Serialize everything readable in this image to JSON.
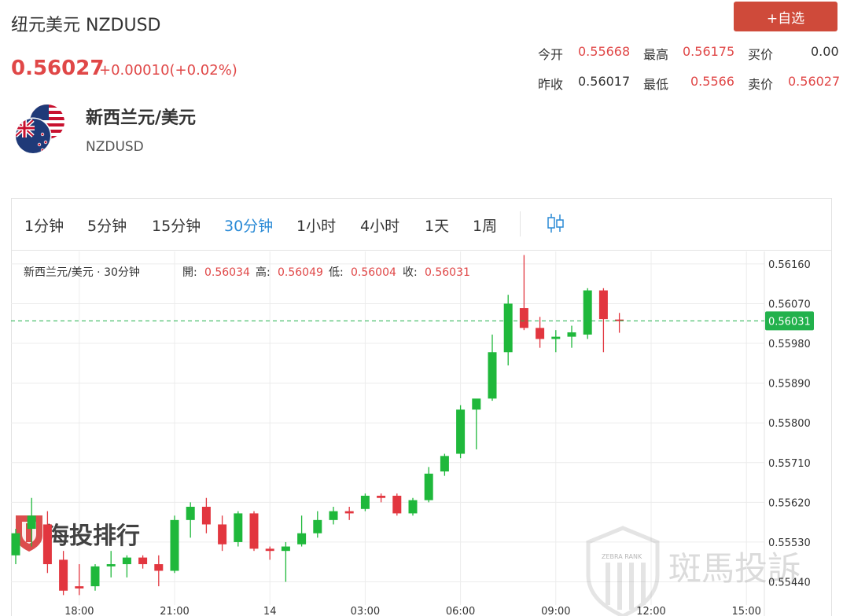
{
  "header": {
    "title": "纽元美元 NZDUSD",
    "price": "0.56027",
    "change": "+0.00010(+0.02%)",
    "fav_button": "+自选"
  },
  "stats": {
    "open_label": "今开",
    "open_value": "0.55668",
    "high_label": "最高",
    "high_value": "0.56175",
    "bid_label": "买价",
    "bid_value": "0.00",
    "prev_label": "昨收",
    "prev_value": "0.56017",
    "low_label": "最低",
    "low_value": "0.5566",
    "ask_label": "卖价",
    "ask_value": "0.56027"
  },
  "pair": {
    "name": "新西兰元/美元",
    "code": "NZDUSD"
  },
  "tabs": [
    "1分钟",
    "5分钟",
    "15分钟",
    "30分钟",
    "1小时",
    "4小时",
    "1天",
    "1周"
  ],
  "active_tab": "30分钟",
  "chart_info": {
    "name": "新西兰元/美元 · 30分钟",
    "open_label": "開:",
    "open": "0.56034",
    "high_label": "高:",
    "high": "0.56049",
    "low_label": "低:",
    "low": "0.56004",
    "close_label": "收:",
    "close": "0.56031"
  },
  "watermarks": {
    "left": "海投排行",
    "right": "斑馬投訴",
    "badge": "ZEBRA RANK"
  },
  "colors": {
    "up": "#1fb83b",
    "down": "#e2363f",
    "accent_red": "#e04747",
    "active_blue": "#2a8ad6",
    "last_price": "#22b14c"
  },
  "chart_data": {
    "type": "candlestick",
    "ylim": [
      0.554,
      0.5619
    ],
    "y_ticks": [
      "0.56160",
      "0.56070",
      "0.55980",
      "0.55890",
      "0.55800",
      "0.55710",
      "0.55620",
      "0.55530",
      "0.55440"
    ],
    "x_ticks": [
      {
        "label": "18:00",
        "index": 4
      },
      {
        "label": "21:00",
        "index": 10
      },
      {
        "label": "14",
        "index": 16
      },
      {
        "label": "03:00",
        "index": 22
      },
      {
        "label": "06:00",
        "index": 28
      },
      {
        "label": "09:00",
        "index": 34
      },
      {
        "label": "12:00",
        "index": 40
      },
      {
        "label": "15:00",
        "index": 46
      }
    ],
    "last_price": "0.56031",
    "last_price_value": 0.56031,
    "candles": [
      {
        "o": 0.555,
        "h": 0.5556,
        "l": 0.5548,
        "c": 0.5555
      },
      {
        "o": 0.5556,
        "h": 0.5563,
        "l": 0.5552,
        "c": 0.5559
      },
      {
        "o": 0.5557,
        "h": 0.556,
        "l": 0.5546,
        "c": 0.5548
      },
      {
        "o": 0.5549,
        "h": 0.5551,
        "l": 0.5541,
        "c": 0.5542
      },
      {
        "o": 0.5543,
        "h": 0.5548,
        "l": 0.5541,
        "c": 0.55425
      },
      {
        "o": 0.5543,
        "h": 0.5548,
        "l": 0.5542,
        "c": 0.55475
      },
      {
        "o": 0.55475,
        "h": 0.5551,
        "l": 0.5545,
        "c": 0.5548
      },
      {
        "o": 0.5548,
        "h": 0.555,
        "l": 0.5545,
        "c": 0.55495
      },
      {
        "o": 0.55495,
        "h": 0.555,
        "l": 0.5547,
        "c": 0.5548
      },
      {
        "o": 0.5548,
        "h": 0.555,
        "l": 0.5543,
        "c": 0.55465
      },
      {
        "o": 0.55465,
        "h": 0.5559,
        "l": 0.5546,
        "c": 0.5558
      },
      {
        "o": 0.5558,
        "h": 0.5562,
        "l": 0.5554,
        "c": 0.5561
      },
      {
        "o": 0.5561,
        "h": 0.5563,
        "l": 0.5555,
        "c": 0.5557
      },
      {
        "o": 0.5557,
        "h": 0.5559,
        "l": 0.5551,
        "c": 0.55525
      },
      {
        "o": 0.5553,
        "h": 0.556,
        "l": 0.5552,
        "c": 0.55595
      },
      {
        "o": 0.55595,
        "h": 0.556,
        "l": 0.5551,
        "c": 0.55515
      },
      {
        "o": 0.55515,
        "h": 0.5552,
        "l": 0.5549,
        "c": 0.5551
      },
      {
        "o": 0.5551,
        "h": 0.5553,
        "l": 0.5544,
        "c": 0.5552
      },
      {
        "o": 0.55525,
        "h": 0.5559,
        "l": 0.5552,
        "c": 0.5555
      },
      {
        "o": 0.5555,
        "h": 0.556,
        "l": 0.5554,
        "c": 0.5558
      },
      {
        "o": 0.5558,
        "h": 0.5561,
        "l": 0.5557,
        "c": 0.556
      },
      {
        "o": 0.556,
        "h": 0.5561,
        "l": 0.5558,
        "c": 0.55595
      },
      {
        "o": 0.55605,
        "h": 0.5564,
        "l": 0.556,
        "c": 0.55635
      },
      {
        "o": 0.55635,
        "h": 0.5564,
        "l": 0.5562,
        "c": 0.5563
      },
      {
        "o": 0.55635,
        "h": 0.5564,
        "l": 0.5559,
        "c": 0.55595
      },
      {
        "o": 0.55595,
        "h": 0.5563,
        "l": 0.5559,
        "c": 0.55625
      },
      {
        "o": 0.55625,
        "h": 0.557,
        "l": 0.5562,
        "c": 0.55685
      },
      {
        "o": 0.5569,
        "h": 0.5573,
        "l": 0.5568,
        "c": 0.55725
      },
      {
        "o": 0.5573,
        "h": 0.5584,
        "l": 0.5572,
        "c": 0.5583
      },
      {
        "o": 0.5583,
        "h": 0.5585,
        "l": 0.5574,
        "c": 0.55855
      },
      {
        "o": 0.55855,
        "h": 0.56,
        "l": 0.5585,
        "c": 0.5596
      },
      {
        "o": 0.5596,
        "h": 0.5609,
        "l": 0.5593,
        "c": 0.5607
      },
      {
        "o": 0.5606,
        "h": 0.5618,
        "l": 0.5601,
        "c": 0.56015
      },
      {
        "o": 0.56015,
        "h": 0.5604,
        "l": 0.5597,
        "c": 0.5599
      },
      {
        "o": 0.5599,
        "h": 0.5601,
        "l": 0.5596,
        "c": 0.55995
      },
      {
        "o": 0.55995,
        "h": 0.5602,
        "l": 0.5597,
        "c": 0.56005
      },
      {
        "o": 0.56,
        "h": 0.56105,
        "l": 0.5599,
        "c": 0.561
      },
      {
        "o": 0.561,
        "h": 0.56105,
        "l": 0.5596,
        "c": 0.56035
      },
      {
        "o": 0.56034,
        "h": 0.56049,
        "l": 0.56004,
        "c": 0.56031
      }
    ]
  }
}
